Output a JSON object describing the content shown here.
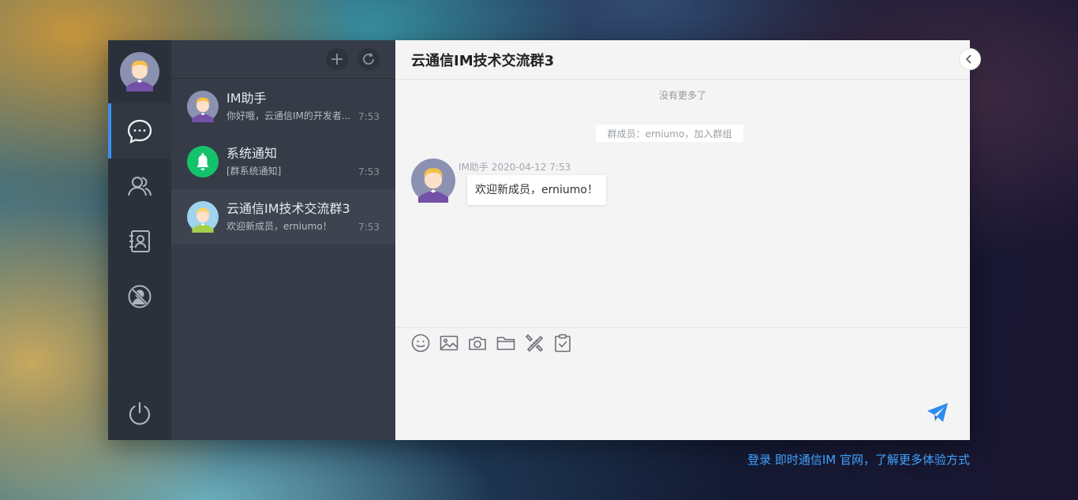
{
  "sessions": [
    {
      "name": "IM助手",
      "preview": "你好哦，云通信IM的开发者...",
      "time": "7:53",
      "avatar": "purple-person-avatar"
    },
    {
      "name": "系统通知",
      "preview": "[群系统通知]",
      "time": "7:53",
      "avatar": "bell-icon"
    },
    {
      "name": "云通信IM技术交流群3",
      "preview": "欢迎新成员，erniumo！",
      "time": "7:53",
      "avatar": "green-person-avatar"
    }
  ],
  "chat": {
    "title": "云通信IM技术交流群3",
    "no_more": "没有更多了",
    "notice": "群成员：erniumo，加入群组",
    "message": {
      "sender_meta": "IM助手 2020-04-12 7:53",
      "text": "欢迎新成员，erniumo！"
    }
  },
  "footer": {
    "link_text": "登录 即时通信IM 官网，了解更多体验方式"
  },
  "icons": {
    "rail": [
      "chat-bubble-icon",
      "contacts-icon",
      "address-book-icon",
      "blocked-user-icon",
      "power-icon"
    ],
    "toolbar": [
      "plus-icon",
      "refresh-icon"
    ],
    "composer": [
      "emoji-icon",
      "image-icon",
      "camera-icon",
      "folder-icon",
      "tools-icon",
      "clipboard-check-icon",
      "send-icon"
    ]
  },
  "colors": {
    "accent": "#3c8ff0",
    "notification_green": "#13c36b",
    "link": "#3fa3ff"
  }
}
